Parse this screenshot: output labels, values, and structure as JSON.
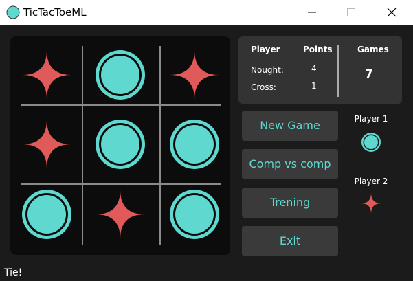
{
  "window": {
    "title": "TicTacToeML"
  },
  "board": {
    "cells": [
      "cross",
      "nought",
      "cross",
      "cross",
      "nought",
      "nought",
      "nought",
      "cross",
      "nought"
    ]
  },
  "scoreboard": {
    "player_header": "Player",
    "points_header": "Points",
    "games_header": "Games",
    "nought_label": "Nought:",
    "nought_points": "4",
    "cross_label": "Cross:",
    "cross_points": "1",
    "games_count": "7"
  },
  "buttons": {
    "new_game": "New Game",
    "comp_vs_comp": "Comp vs comp",
    "trening": "Trening",
    "exit": "Exit"
  },
  "players": {
    "player1_label": "Player 1",
    "player1_symbol": "nought",
    "player2_label": "Player 2",
    "player2_symbol": "cross"
  },
  "status": {
    "text": "Tie!"
  },
  "colors": {
    "nought": "#5fd8d0",
    "cross": "#e05a5a",
    "accent_text": "#5fd8d0"
  }
}
